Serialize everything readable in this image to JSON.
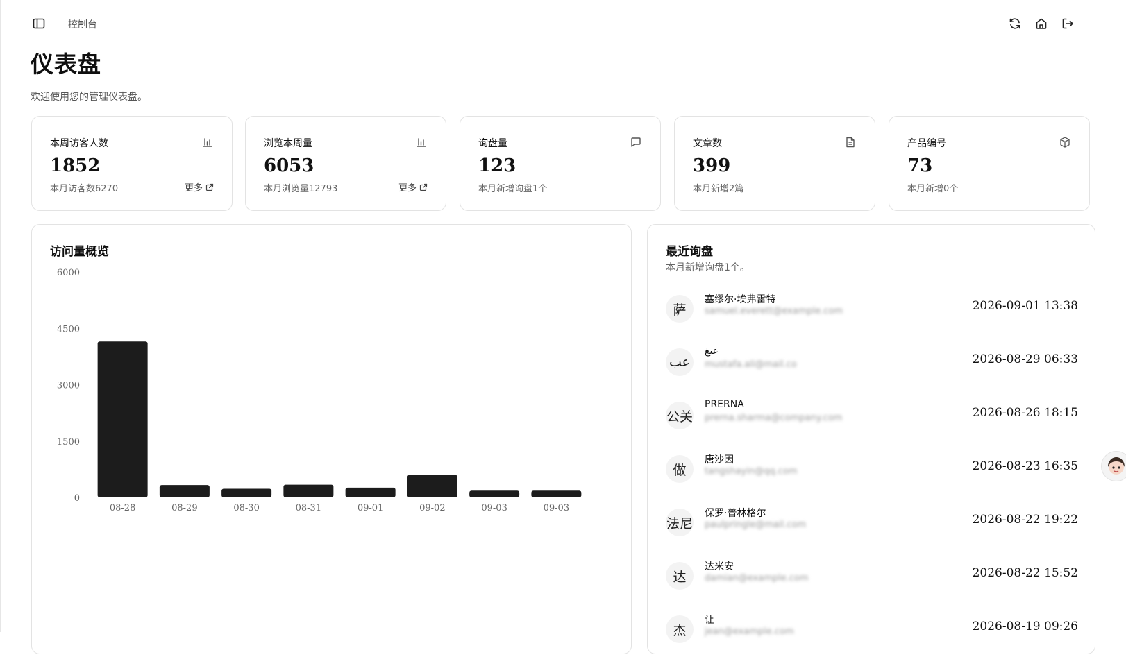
{
  "header": {
    "breadcrumb": "控制台",
    "icons": [
      "sidebar-toggle-icon",
      "refresh-icon",
      "home-icon",
      "logout-icon"
    ]
  },
  "page": {
    "title": "仪表盘",
    "subtitle": "欢迎使用您的管理仪表盘。"
  },
  "stats": [
    {
      "title": "本周访客人数",
      "value": "1852",
      "sub": "本月访客数6270",
      "more": "更多",
      "icon": "bar-chart-icon"
    },
    {
      "title": "浏览本周量",
      "value": "6053",
      "sub": "本月浏览量12793",
      "more": "更多",
      "icon": "bar-chart-icon"
    },
    {
      "title": "询盘量",
      "value": "123",
      "sub": "本月新增询盘1个",
      "icon": "message-icon"
    },
    {
      "title": "文章数",
      "value": "399",
      "sub": "本月新增2篇",
      "icon": "document-icon"
    },
    {
      "title": "产品编号",
      "value": "73",
      "sub": "本月新增0个",
      "icon": "cube-icon"
    }
  ],
  "traffic": {
    "title": "访问量概览"
  },
  "chart_data": {
    "type": "bar",
    "categories": [
      "08-28",
      "08-29",
      "08-30",
      "08-31",
      "09-01",
      "09-02",
      "09-03",
      "09-03"
    ],
    "values": [
      4150,
      330,
      230,
      340,
      260,
      600,
      180,
      180
    ],
    "ylim": [
      0,
      6000
    ],
    "yticks": [
      0,
      1500,
      3000,
      4500,
      6000
    ],
    "bar_color": "#1c1c1c",
    "grid": false
  },
  "inquiries": {
    "title": "最近询盘",
    "subtitle": "本月新增询盘1个。",
    "items": [
      {
        "avatar": "萨",
        "name": "塞缪尔·埃弗雷特",
        "email": "samuel.everett@example.com",
        "date": "2026-09-01 13:38"
      },
      {
        "avatar": "عب",
        "name": "عبغ",
        "email": "mustafa.ali@mail.co",
        "date": "2026-08-29 06:33"
      },
      {
        "avatar": "公关",
        "name": "PRERNA",
        "email": "prerna.sharma@company.com",
        "date": "2026-08-26 18:15"
      },
      {
        "avatar": "做",
        "name": "唐沙因",
        "email": "tangshayin@qq.com",
        "date": "2026-08-23 16:35"
      },
      {
        "avatar": "法尼",
        "name": "保罗·普林格尔",
        "email": "paulpringle@mail.com",
        "date": "2026-08-22 19:22"
      },
      {
        "avatar": "达",
        "name": "达米安",
        "email": "damian@example.com",
        "date": "2026-08-22 15:52"
      },
      {
        "avatar": "杰",
        "name": "让",
        "email": "jean@example.com",
        "date": "2026-08-19 09:26"
      }
    ]
  }
}
